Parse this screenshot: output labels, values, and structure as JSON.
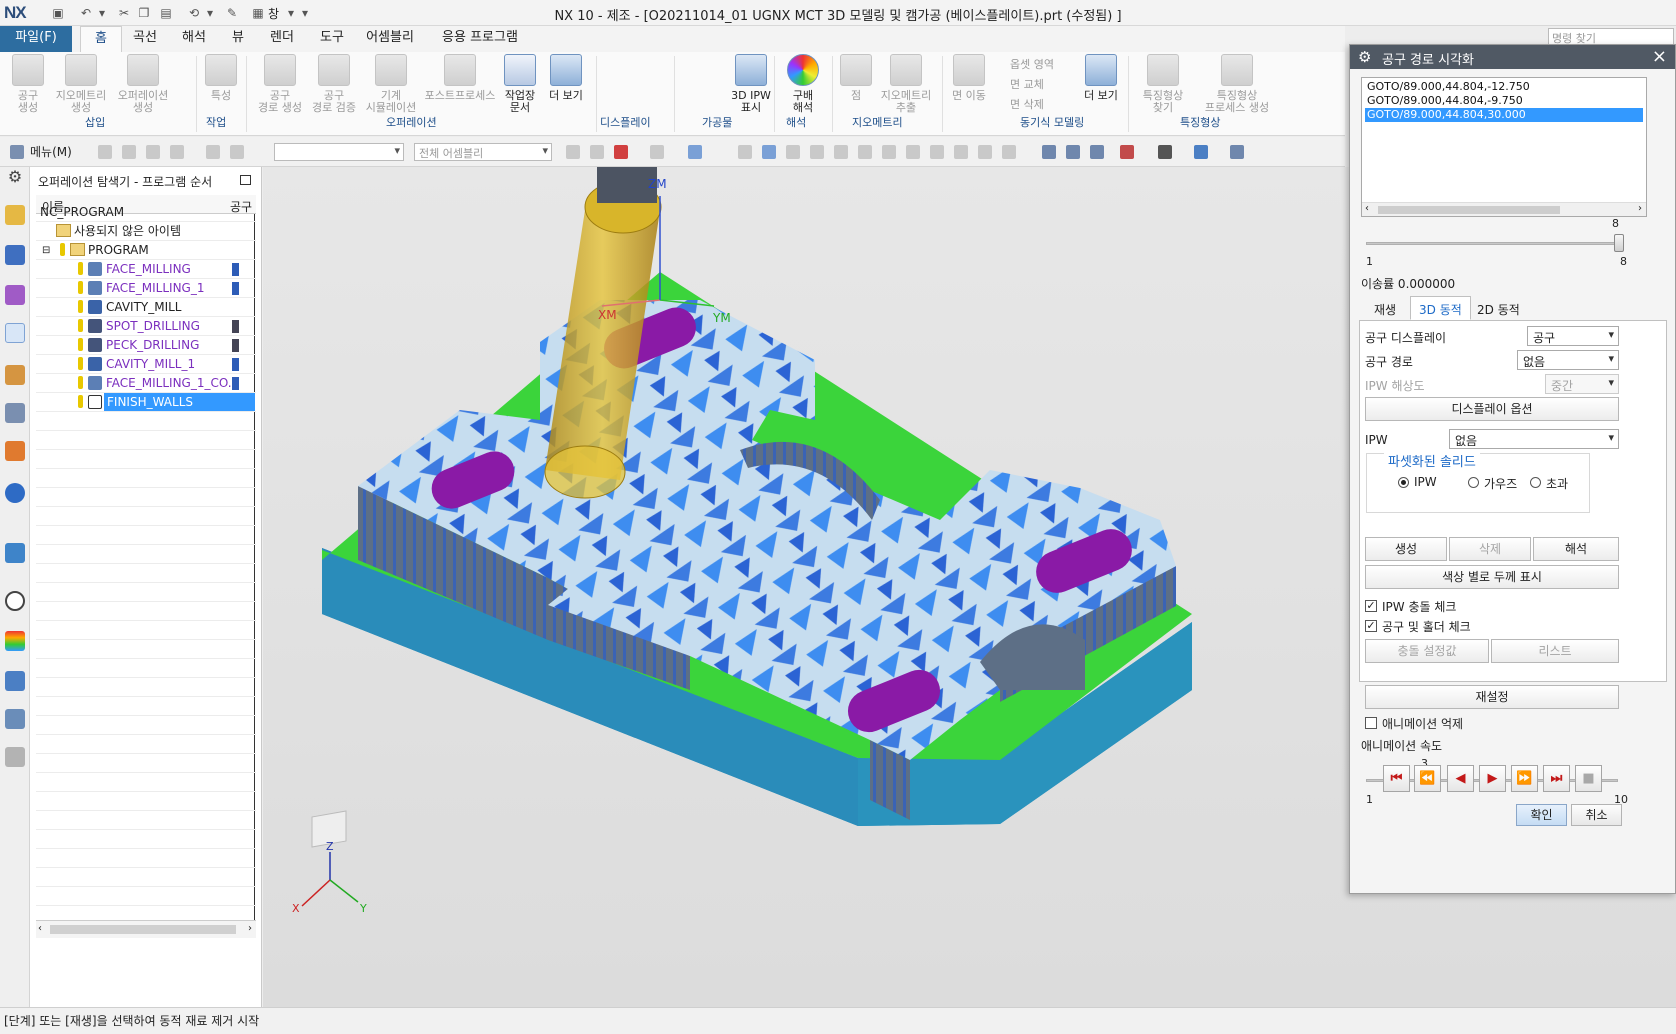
{
  "window": {
    "logo": "NX",
    "title": "NX 10 - 제조 - [O20211014_01 UGNX MCT 3D 모델링 및 캠가공 (베이스플레이트).prt (수정됨) ]",
    "window_menu": "창",
    "command_search_placeholder": "명령 찾기"
  },
  "ribbon": {
    "tabs": [
      "파일(F)",
      "홈",
      "곡선",
      "해석",
      "뷰",
      "렌더",
      "도구",
      "어셈블리",
      "응용 프로그램"
    ],
    "active_tab": "홈",
    "buttons": {
      "tool_create": "공구\n생성",
      "geometry_create": "지오메트리\n생성",
      "operation_create": "오퍼레이션\n생성",
      "feature": "특성",
      "toolpath_create": "공구\n경로 생성",
      "toolpath_verify": "공구\n경로 검증",
      "machine_sim": "기계\n시뮬레이션",
      "postprocess": "포스트프로세스",
      "shop_doc": "작업장\n문서",
      "more_op": "더 보기",
      "ipw_3d": "3D IPW\n표시",
      "gradient": "구배\n해석",
      "point": "점",
      "geometry_extrude": "지오메트리\n추출",
      "face_move": "면 이동",
      "more_sync": "더 보기",
      "feature_find": "특징형상\n찾기",
      "feature_process": "특징형상\n프로세스 생성"
    },
    "small_buttons": {
      "offset_region": "옵셋 영역",
      "face_replace": "면 교체",
      "face_delete": "면 삭제"
    },
    "groups": {
      "insert": "삽입",
      "work": "작업",
      "operation": "오퍼레이션",
      "display": "디스플레이",
      "workpiece": "가공물",
      "analysis": "해석",
      "geometry": "지오메트리",
      "sync_modeling": "동기식 모델링",
      "feature": "특징형상"
    }
  },
  "toolbar2": {
    "menu_label": "메뉴(M)",
    "filter_value": "",
    "assembly_scope": "전체 어셈블리"
  },
  "navigator": {
    "title": "오퍼레이션 탐색기 - 프로그램 순서",
    "col_name": "이름",
    "col_tool": "공구",
    "rows": [
      {
        "label": "NC_PROGRAM",
        "kind": "root"
      },
      {
        "label": "사용되지 않은 아이템",
        "kind": "folder"
      },
      {
        "label": "PROGRAM",
        "kind": "program"
      },
      {
        "label": "FACE_MILLING",
        "kind": "op"
      },
      {
        "label": "FACE_MILLING_1",
        "kind": "op"
      },
      {
        "label": "CAVITY_MILL",
        "kind": "op-plain"
      },
      {
        "label": "SPOT_DRILLING",
        "kind": "op"
      },
      {
        "label": "PECK_DRILLING",
        "kind": "op"
      },
      {
        "label": "CAVITY_MILL_1",
        "kind": "op"
      },
      {
        "label": "FACE_MILLING_1_CO...",
        "kind": "op"
      },
      {
        "label": "FINISH_WALLS",
        "kind": "selected"
      }
    ]
  },
  "viewport": {
    "axis_labels": {
      "zm": "ZM",
      "xm": "XM",
      "ym": "YM"
    },
    "triad_labels": {
      "z": "Z",
      "x": "X",
      "y": "Y"
    }
  },
  "dialog": {
    "title": "공구 경로 시각화",
    "goto_lines": [
      "GOTO/89.000,44.804,-12.750",
      "GOTO/89.000,44.804,-9.750",
      "GOTO/89.000,44.804,30.000"
    ],
    "selected_goto_index": 2,
    "step_slider": {
      "value": "8",
      "min": "1",
      "max": "8"
    },
    "feed_rate_label": "이송률 0.000000",
    "tabs": [
      "재생",
      "3D 동적",
      "2D 동적"
    ],
    "active_tab": "3D 동적",
    "tool_display_label": "공구 디스플레이",
    "tool_display_value": "공구",
    "toolpath_label": "공구 경로",
    "toolpath_value": "없음",
    "ipw_resolution_label": "IPW 해상도",
    "ipw_resolution_value": "중간",
    "display_options_button": "디스플레이 옵션",
    "ipw_label": "IPW",
    "ipw_value": "없음",
    "faceted_solid_title": "파셋화된 솔리드",
    "radio_ipw": "IPW",
    "radio_gouge": "가우즈",
    "radio_excess": "초과",
    "create_button": "생성",
    "delete_button": "삭제",
    "analyze_button": "해석",
    "color_thickness_button": "색상 별로 두께 표시",
    "ipw_collision_check": "IPW 충돌 체크",
    "tool_holder_check": "공구 및 홀더 체크",
    "collision_settings_button": "충돌 설정값",
    "list_button": "리스트",
    "reset_button": "재설정",
    "suppress_animation": "애니메이션 억제",
    "anim_speed_label": "애니메이션 속도",
    "anim_speed": {
      "value": "3",
      "min": "1",
      "max": "10",
      "fraction": 0.22
    },
    "ok_button": "확인",
    "cancel_button": "취소"
  },
  "status": {
    "text": "[단계] 또는 [재생]을 선택하여 동적 재료 제거 시작"
  }
}
